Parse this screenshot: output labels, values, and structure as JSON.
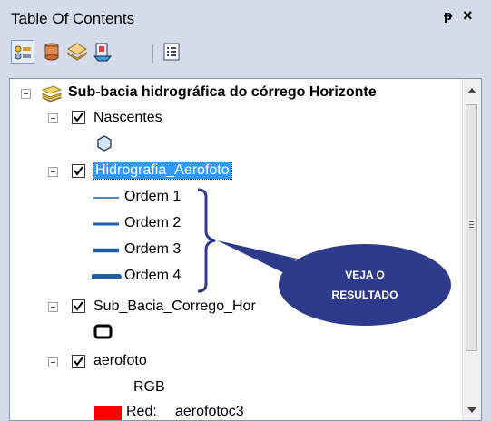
{
  "panel": {
    "title": "Table Of Contents",
    "pin_glyph": "ᵽ",
    "close_glyph": "×"
  },
  "toolbar": {
    "icons": [
      "list-by-drawing-order-icon",
      "list-by-source-icon",
      "list-by-visibility-icon",
      "list-by-selection-icon",
      "options-icon"
    ],
    "selected_index": 0
  },
  "tree": {
    "root": {
      "label": "Sub-bacia hidrográfica do córrego Horizonte"
    },
    "layers": [
      {
        "label": "Nascentes",
        "checked": true
      },
      {
        "label": "Hidrografia_Aerofoto",
        "checked": true,
        "selected": true,
        "classes": [
          "Ordem 1",
          "Ordem 2",
          "Ordem 3",
          "Ordem 4"
        ]
      },
      {
        "label": "Sub_Bacia_Corrego_Hor",
        "checked": true
      },
      {
        "label": "aerofoto",
        "checked": true,
        "band_title": "RGB",
        "bands": [
          {
            "label": "Red:",
            "value": "aerofotoc3",
            "color": "#ff0000"
          }
        ]
      }
    ]
  },
  "callout": {
    "line1": "VEJA O",
    "line2": "RESULTADO",
    "fill": "#2e3a8c",
    "bracket_color": "#2e3a8c"
  },
  "colors": {
    "water_symbol": "#1f5fa8",
    "point_fill": "#cfe6f7"
  }
}
